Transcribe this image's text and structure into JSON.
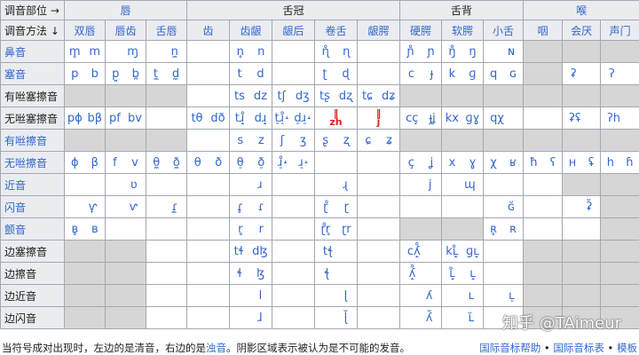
{
  "corner": {
    "place": "调音部位 →",
    "manner": "调音方法 ↓"
  },
  "groups": [
    "唇",
    "舌冠",
    "舌背",
    "喉"
  ],
  "places": [
    "双唇",
    "唇齿",
    "舌唇",
    "齿",
    "齿龈",
    "龈后",
    "卷舌",
    "龈腭",
    "硬腭",
    "软腭",
    "小舌",
    "咽",
    "会厌",
    "声门"
  ],
  "rows": [
    {
      "manner": "鼻音",
      "link": true,
      "cells": [
        [
          "m̥",
          "m"
        ],
        [
          "",
          "ɱ"
        ],
        [
          "",
          "n̼"
        ],
        [
          "",
          ""
        ],
        [
          "n̥",
          "n"
        ],
        [
          "",
          ""
        ],
        [
          "ɳ̊",
          "ɳ"
        ],
        [
          "",
          ""
        ],
        [
          "ɲ̊",
          "ɲ"
        ],
        [
          "ŋ̊",
          "ŋ"
        ],
        [
          "",
          "ɴ"
        ],
        null,
        null,
        null
      ]
    },
    {
      "manner": "塞音",
      "link": true,
      "cells": [
        [
          "p",
          "b"
        ],
        [
          "p̪",
          "b̪"
        ],
        [
          "t̼",
          "d̼"
        ],
        [
          "",
          ""
        ],
        [
          "t",
          "d"
        ],
        [
          "",
          ""
        ],
        [
          "ʈ",
          "ɖ"
        ],
        [
          "",
          ""
        ],
        [
          "c",
          "ɟ"
        ],
        [
          "k",
          "ɡ"
        ],
        [
          "q",
          "ɢ"
        ],
        null,
        [
          "ʡ",
          ""
        ],
        [
          "ʔ",
          ""
        ]
      ]
    },
    {
      "manner": "有咝塞擦音",
      "link": false,
      "cells": [
        null,
        null,
        null,
        [
          "",
          ""
        ],
        [
          "ts",
          "dz"
        ],
        [
          "tʃ",
          "dʒ"
        ],
        [
          "tʂ",
          "dʐ"
        ],
        [
          "tɕ",
          "dʑ"
        ],
        null,
        null,
        null,
        null,
        null,
        null
      ]
    },
    {
      "manner": "无咝塞擦音",
      "link": false,
      "cells": [
        [
          "pɸ",
          "bβ"
        ],
        [
          "pf",
          "bv"
        ],
        [
          "",
          ""
        ],
        [
          "tθ",
          "dð"
        ],
        [
          "tɹ̝̊",
          "dɹ̝"
        ],
        [
          "t̠ɹ̠̊˔",
          "d̠ɹ̠˔"
        ],
        [
          "red:zh",
          ""
        ],
        [
          "red:j",
          ""
        ],
        [
          "cç",
          "ɟʝ"
        ],
        [
          "kx",
          "ɡɣ"
        ],
        [
          "qχ",
          ""
        ],
        [
          "",
          ""
        ],
        [
          "ʡʢ",
          ""
        ],
        [
          "ʔh",
          ""
        ]
      ]
    },
    {
      "manner": "有咝擦音",
      "link": true,
      "cells": [
        null,
        null,
        null,
        [
          "",
          ""
        ],
        [
          "s",
          "z"
        ],
        [
          "ʃ",
          "ʒ"
        ],
        [
          "ʂ",
          "ʐ"
        ],
        [
          "ɕ",
          "ʑ"
        ],
        null,
        null,
        null,
        null,
        null,
        null
      ]
    },
    {
      "manner": "无咝擦音",
      "link": true,
      "cells": [
        [
          "ɸ",
          "β"
        ],
        [
          "f",
          "v"
        ],
        [
          "θ̼",
          "ð̼"
        ],
        [
          "θ",
          "ð"
        ],
        [
          "θ̠",
          "ð̠"
        ],
        [
          "ɹ̠̊˔",
          "ɹ̠˔"
        ],
        [
          "",
          ""
        ],
        [
          "",
          ""
        ],
        [
          "ç",
          "ʝ"
        ],
        [
          "x",
          "ɣ"
        ],
        [
          "χ",
          "ʁ"
        ],
        [
          "ħ",
          "ʕ"
        ],
        [
          "ʜ",
          "ʢ"
        ],
        [
          "h",
          "ɦ"
        ]
      ]
    },
    {
      "manner": "近音",
      "link": true,
      "cells": [
        [
          "",
          ""
        ],
        [
          "",
          "ʋ"
        ],
        [
          "",
          ""
        ],
        [
          "",
          ""
        ],
        [
          "",
          "ɹ"
        ],
        [
          "",
          ""
        ],
        [
          "",
          "ɻ"
        ],
        [
          "",
          ""
        ],
        [
          "",
          "j"
        ],
        [
          "",
          "ɰ"
        ],
        [
          "",
          ""
        ],
        [
          "",
          ""
        ],
        null,
        null
      ]
    },
    {
      "manner": "闪音",
      "link": true,
      "cells": [
        [
          "",
          "ⱱ̟"
        ],
        [
          "",
          "ⱱ"
        ],
        [
          "",
          "ɾ̼"
        ],
        [
          "",
          ""
        ],
        [
          "ɾ̥",
          "ɾ"
        ],
        [
          "",
          ""
        ],
        [
          "ɽ̊",
          "ɽ"
        ],
        [
          "",
          ""
        ],
        [
          "",
          ""
        ],
        [
          "",
          ""
        ],
        [
          "",
          "ɢ̆"
        ],
        [
          "",
          ""
        ],
        [
          "",
          "ʡ̆"
        ],
        null
      ]
    },
    {
      "manner": "颤音",
      "link": true,
      "cells": [
        [
          "ʙ̥",
          "ʙ"
        ],
        [
          "",
          ""
        ],
        [
          "",
          ""
        ],
        [
          "",
          ""
        ],
        [
          "r̥",
          "r"
        ],
        [
          "",
          ""
        ],
        [
          "ɽ̊r̥",
          "ɽr"
        ],
        [
          "",
          ""
        ],
        null,
        null,
        [
          "ʀ̥",
          "ʀ"
        ],
        [
          "",
          ""
        ],
        [
          "",
          ""
        ],
        null
      ]
    },
    {
      "manner": "边塞擦音",
      "link": false,
      "cells": [
        null,
        null,
        [
          "",
          ""
        ],
        [
          "",
          ""
        ],
        [
          "tɬ",
          "dɮ"
        ],
        [
          "",
          ""
        ],
        [
          "tꞎ",
          ""
        ],
        [
          "",
          ""
        ],
        [
          "cʎ̝̊",
          ""
        ],
        [
          "kʟ̝̊",
          "ɡʟ̝"
        ],
        [
          "",
          ""
        ],
        null,
        null,
        null
      ]
    },
    {
      "manner": "边擦音",
      "link": false,
      "cells": [
        null,
        null,
        [
          "",
          ""
        ],
        [
          "",
          ""
        ],
        [
          "ɬ",
          "ɮ"
        ],
        [
          "",
          ""
        ],
        [
          "ꞎ",
          ""
        ],
        [
          "",
          ""
        ],
        [
          "ʎ̝̊",
          ""
        ],
        [
          "ʟ̝̊",
          "ʟ̝"
        ],
        [
          "",
          ""
        ],
        null,
        null,
        null
      ]
    },
    {
      "manner": "边近音",
      "link": false,
      "cells": [
        null,
        null,
        [
          "",
          ""
        ],
        [
          "",
          ""
        ],
        [
          "",
          "l"
        ],
        [
          "",
          ""
        ],
        [
          "",
          "ɭ"
        ],
        [
          "",
          ""
        ],
        [
          "",
          "ʎ"
        ],
        [
          "",
          "ʟ"
        ],
        [
          "",
          "ʟ̠"
        ],
        null,
        null,
        null
      ]
    },
    {
      "manner": "边闪音",
      "link": false,
      "cells": [
        null,
        null,
        [
          "",
          ""
        ],
        [
          "",
          ""
        ],
        [
          "",
          "ɺ"
        ],
        [
          "",
          ""
        ],
        [
          "",
          "ɭ̆"
        ],
        [
          "",
          ""
        ],
        [
          "",
          "ʎ̆"
        ],
        [
          "",
          "ʟ̆"
        ],
        [
          "",
          ""
        ],
        null,
        null,
        null
      ]
    }
  ],
  "footer": {
    "note_a": "当符号成对出现时，左边的是清音，右边的是",
    "note_link": "浊音",
    "note_b": "。阴影区域表示被认为是不可能的发音。",
    "link1": "国际音标帮助",
    "sep1": " • ",
    "link2": "国际音标表",
    "sep2": " • ",
    "link3": "模板"
  },
  "watermark": "知乎 @TAimeur",
  "colors": {
    "link": "#3366cc",
    "header_bg": "#eaecf0",
    "shade": "#d6d6d6",
    "red": "#dd2222",
    "border": "#a2a9b1"
  }
}
